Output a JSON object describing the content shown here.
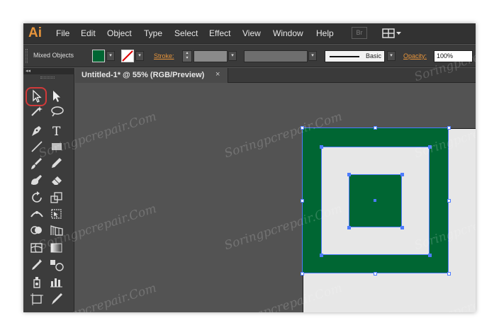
{
  "app": {
    "logo": "Ai"
  },
  "menu": [
    "File",
    "Edit",
    "Object",
    "Type",
    "Select",
    "Effect",
    "View",
    "Window",
    "Help"
  ],
  "bridge_button": "Br",
  "control": {
    "selection_label": "Mixed Objects",
    "fill_color": "#006633",
    "stroke_label": "Stroke:",
    "stroke_style": "Basic",
    "opacity_label": "Opacity:",
    "opacity_value": "100%"
  },
  "panel": {
    "collapse": "◂◂"
  },
  "document": {
    "tab_title": "Untitled-1* @ 55% (RGB/Preview)",
    "close": "×"
  },
  "artwork": {
    "green": "#006633",
    "light": "#e7e7e7",
    "selection": "#4d7cff"
  },
  "watermark": "Soringpcrepair.Com",
  "icons": [
    "selection-tool-icon",
    "direct-selection-tool-icon",
    "magic-wand-tool-icon",
    "lasso-tool-icon",
    "pen-tool-icon",
    "type-tool-icon",
    "line-segment-tool-icon",
    "rectangle-tool-icon",
    "paintbrush-tool-icon",
    "pencil-tool-icon",
    "blob-brush-tool-icon",
    "eraser-tool-icon",
    "rotate-tool-icon",
    "scale-tool-icon",
    "width-tool-icon",
    "free-transform-tool-icon",
    "shape-builder-tool-icon",
    "perspective-grid-tool-icon",
    "mesh-tool-icon",
    "gradient-tool-icon",
    "eyedropper-tool-icon",
    "blend-tool-icon",
    "symbol-sprayer-tool-icon",
    "column-graph-tool-icon",
    "artboard-tool-icon",
    "slice-tool-icon"
  ]
}
